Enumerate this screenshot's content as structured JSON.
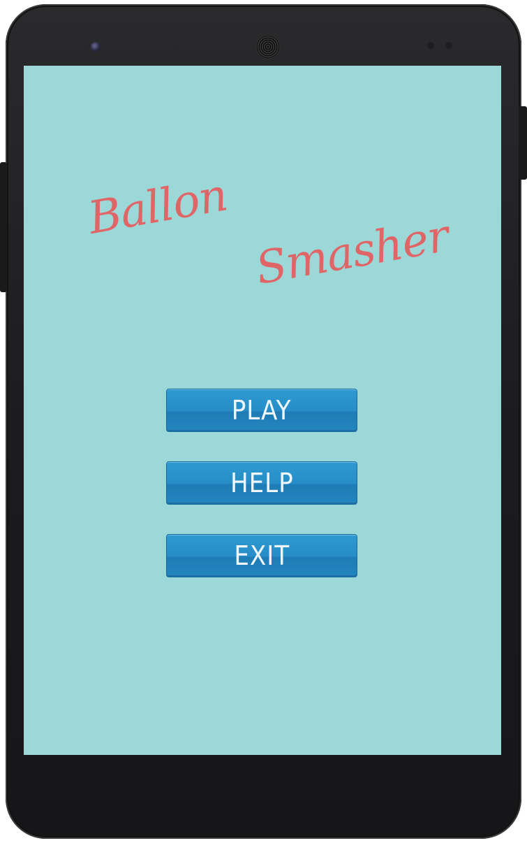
{
  "app": {
    "title_line1": "Ballon",
    "title_line2": "Smasher"
  },
  "menu": {
    "play_label": "PLAY",
    "help_label": "HELP",
    "exit_label": "EXIT"
  },
  "colors": {
    "background": "#9dd8d9",
    "title": "#df6566",
    "button": "#278dc7",
    "button_text": "#eef6fb"
  },
  "icons": [
    "front-camera-icon",
    "speaker-grille-icon"
  ]
}
